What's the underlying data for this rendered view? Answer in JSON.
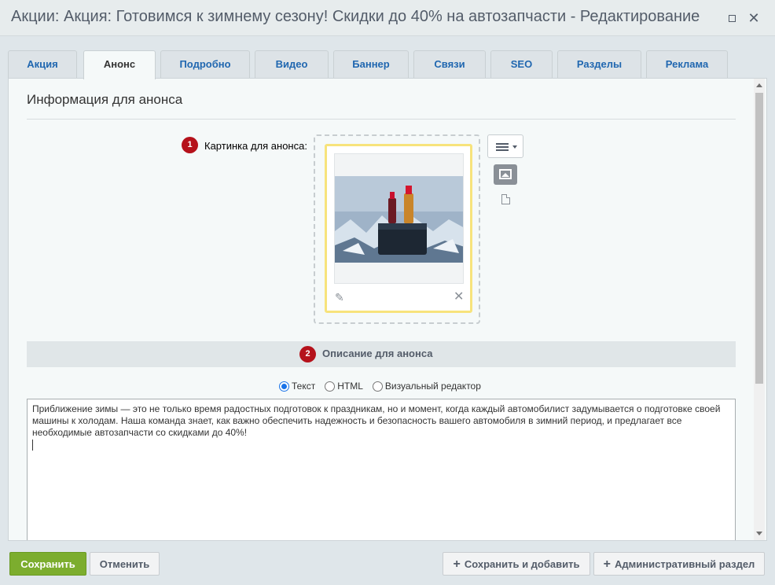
{
  "window": {
    "title": "Акции: Акция: Готовимся к зимнему сезону! Скидки до 40% на автозапчасти - Редактирование",
    "maximize_icon": "maximize-icon",
    "close_icon": "close-icon",
    "close_glyph": "✕"
  },
  "tabs": [
    {
      "label": "Акция"
    },
    {
      "label": "Анонс",
      "active": true
    },
    {
      "label": "Подробно"
    },
    {
      "label": "Видео"
    },
    {
      "label": "Баннер"
    },
    {
      "label": "Связи"
    },
    {
      "label": "SEO"
    },
    {
      "label": "Разделы"
    },
    {
      "label": "Реклама"
    }
  ],
  "section": {
    "title": "Информация для анонса"
  },
  "picture_field": {
    "badge": "1",
    "label": "Картинка для анонса:",
    "edit_icon": "pencil-icon",
    "edit_glyph": "✎",
    "remove_icon": "remove-icon",
    "remove_glyph": "✕"
  },
  "description": {
    "badge": "2",
    "header": "Описание для анонса",
    "modes": [
      {
        "label": "Текст",
        "checked": true
      },
      {
        "label": "HTML",
        "checked": false
      },
      {
        "label": "Визуальный редактор",
        "checked": false
      }
    ],
    "text": "Приближение зимы — это не только время радостных подготовок к праздникам, но и момент, когда каждый автомобилист задумывается о подготовке своей машины к холодам. Наша команда знает, как важно обеспечить надежность и безопасность вашего автомобиля в зимний период, и предлагает все необходимые автозапчасти со скидками до 40%!"
  },
  "footer": {
    "save": "Сохранить",
    "cancel": "Отменить",
    "save_add": "Сохранить и добавить",
    "admin": "Административный раздел",
    "plus_glyph": "+"
  },
  "colors": {
    "accent_green": "#7cad2e",
    "badge_red": "#b5121b",
    "link_blue": "#2067b0"
  }
}
